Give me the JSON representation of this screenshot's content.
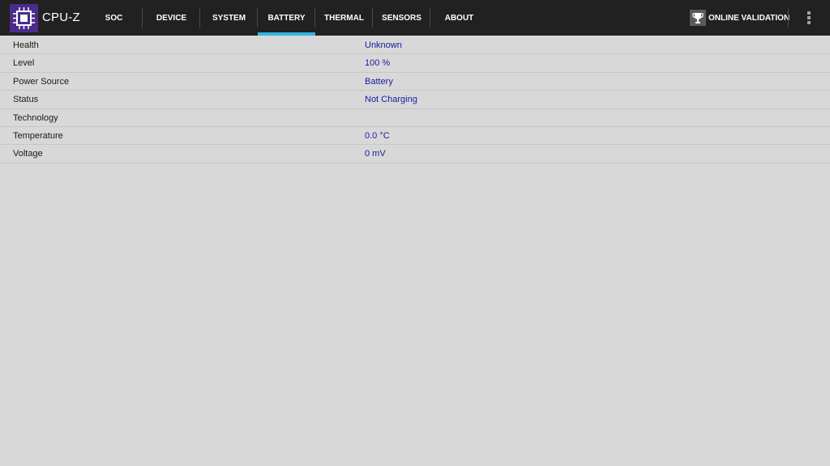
{
  "app": {
    "title": "CPU-Z",
    "logo_icon": "cpu-chip-icon",
    "accent_color": "#33b5e5",
    "logo_color": "#4b2c8a"
  },
  "tabs": [
    {
      "label": "SOC",
      "active": false
    },
    {
      "label": "DEVICE",
      "active": false
    },
    {
      "label": "SYSTEM",
      "active": false
    },
    {
      "label": "BATTERY",
      "active": true
    },
    {
      "label": "THERMAL",
      "active": false
    },
    {
      "label": "SENSORS",
      "active": false
    },
    {
      "label": "ABOUT",
      "active": false
    }
  ],
  "toolbar": {
    "validation_label": "ONLINE VALIDATION",
    "validation_icon": "trophy-icon",
    "menu_icon": "overflow-menu-icon"
  },
  "battery": {
    "rows": [
      {
        "label": "Health",
        "value": "Unknown"
      },
      {
        "label": "Level",
        "value": "100 %"
      },
      {
        "label": "Power Source",
        "value": "Battery"
      },
      {
        "label": "Status",
        "value": "Not Charging"
      },
      {
        "label": "Technology",
        "value": ""
      },
      {
        "label": "Temperature",
        "value": "0.0 °C"
      },
      {
        "label": "Voltage",
        "value": "0 mV"
      }
    ]
  }
}
